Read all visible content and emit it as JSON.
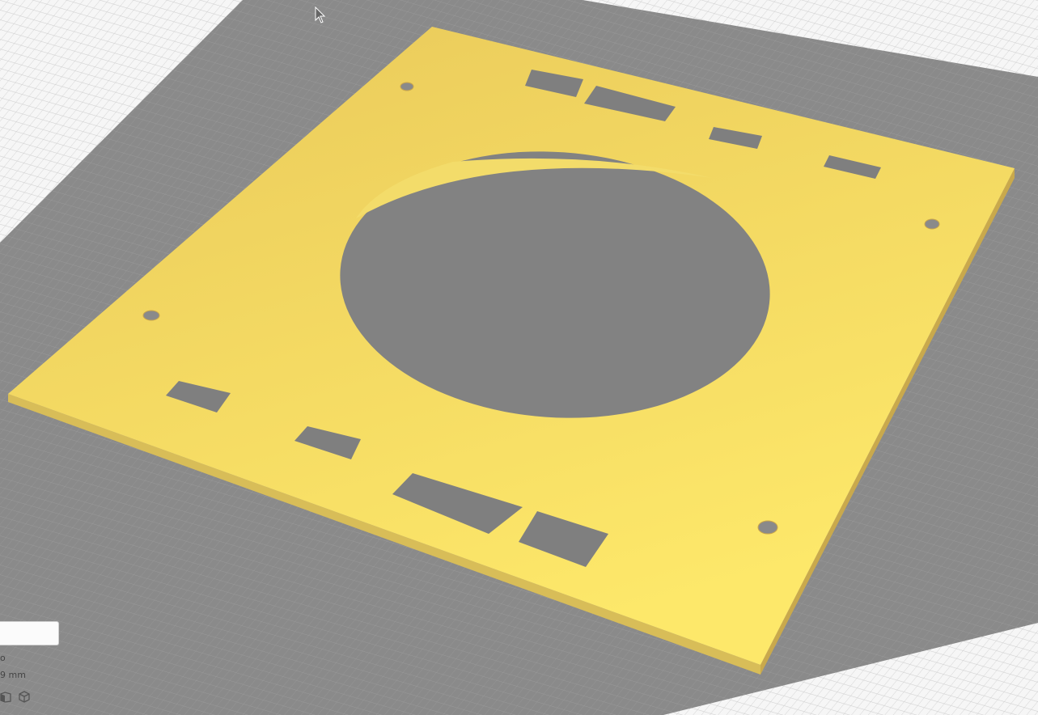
{
  "app": {
    "scene": {
      "background_color": "#f6f6f6",
      "build_plate_color": "#8a8a8a",
      "grid_color": "#cfcfcf",
      "model_color": "#fde86a",
      "model_shade_color": "#e9c95a",
      "model_edge_color": "#d8bd58",
      "hole_color": "#7f7f7f"
    },
    "left_panel": {
      "info_box_value": "",
      "line1": "o",
      "line2": "9 mm",
      "view_icons": [
        "left-side-view-icon",
        "3d-view-icon"
      ]
    },
    "cursor_icon": "mouse-pointer-icon"
  }
}
